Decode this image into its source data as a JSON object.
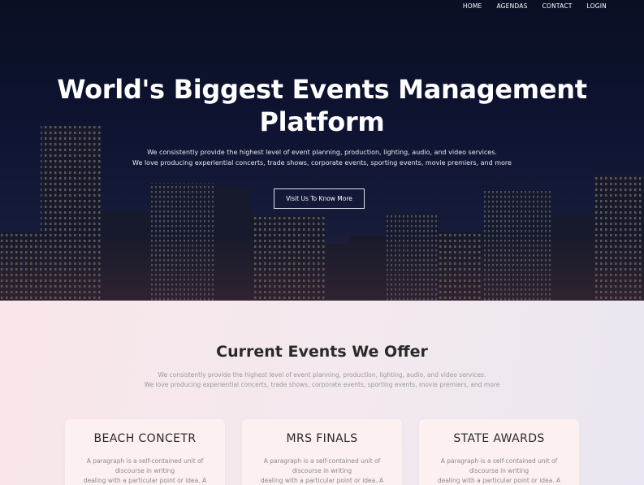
{
  "nav": {
    "items": [
      {
        "label": "HOME"
      },
      {
        "label": "AGENDAS"
      },
      {
        "label": "CONTACT"
      },
      {
        "label": "LOGIN"
      }
    ]
  },
  "hero": {
    "title_line1": "World's Biggest Events Management",
    "title_line2": "Platform",
    "sub_line1": "We consistently provide the highest level of event planning, production, lighting, audio, and video services.",
    "sub_line2": "We love producing experiential concerts, trade shows, corporate events, sporting events, movie premiers, and more",
    "button_label": "Visit Us To Know More"
  },
  "events": {
    "title": "Current Events We Offer",
    "sub_line1": "We consistently provide the highest level of event planning, production, lighting, audio, and video services.",
    "sub_line2": "We love producing experiential concerts, trade shows, corporate events, sporting events, movie premiers, and more",
    "cards": [
      {
        "title": "BEACH CONCETR",
        "line1": "A paragraph is a self-contained unit of",
        "line2": "discourse in writing",
        "line3": "dealing with a particular point or idea. A"
      },
      {
        "title": "MRS FINALS",
        "line1": "A paragraph is a self-contained unit of",
        "line2": "discourse in writing",
        "line3": "dealing with a particular point or idea. A"
      },
      {
        "title": "STATE AWARDS",
        "line1": "A paragraph is a self-contained unit of",
        "line2": "discourse in writing",
        "line3": "dealing with a particular point or idea. A"
      }
    ]
  },
  "colors": {
    "hero_bg": "#0e1432",
    "events_bg": "#f4e9ee",
    "card_bg": "#fdf0f0",
    "title_text": "#2a2a2a"
  }
}
